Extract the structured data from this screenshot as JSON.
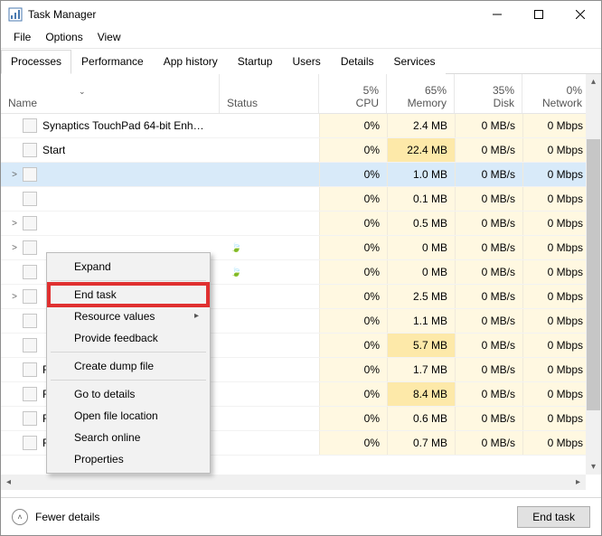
{
  "window": {
    "title": "Task Manager"
  },
  "menus": {
    "file": "File",
    "options": "Options",
    "view": "View"
  },
  "tabs": [
    "Processes",
    "Performance",
    "App history",
    "Startup",
    "Users",
    "Details",
    "Services"
  ],
  "headers": {
    "name": "Name",
    "status": "Status",
    "cpu": {
      "pct": "5%",
      "lbl": "CPU"
    },
    "mem": {
      "pct": "65%",
      "lbl": "Memory"
    },
    "disk": {
      "pct": "35%",
      "lbl": "Disk"
    },
    "net": {
      "pct": "0%",
      "lbl": "Network"
    }
  },
  "rows": [
    {
      "exp": "",
      "name": "Synaptics TouchPad 64-bit Enha...",
      "cpu": "0%",
      "mem": "2.4 MB",
      "disk": "0 MB/s",
      "net": "0 Mbps"
    },
    {
      "exp": "",
      "name": "Start",
      "cpu": "0%",
      "mem": "22.4 MB",
      "disk": "0 MB/s",
      "net": "0 Mbps"
    },
    {
      "exp": ">",
      "name": "",
      "cpu": "0%",
      "mem": "1.0 MB",
      "disk": "0 MB/s",
      "net": "0 Mbps",
      "sel": true
    },
    {
      "exp": "",
      "name": "",
      "cpu": "0%",
      "mem": "0.1 MB",
      "disk": "0 MB/s",
      "net": "0 Mbps"
    },
    {
      "exp": ">",
      "name": "",
      "cpu": "0%",
      "mem": "0.5 MB",
      "disk": "0 MB/s",
      "net": "0 Mbps"
    },
    {
      "exp": ">",
      "name": "",
      "cpu": "0%",
      "mem": "0 MB",
      "disk": "0 MB/s",
      "net": "0 Mbps",
      "leaf": true
    },
    {
      "exp": "",
      "name": "",
      "cpu": "0%",
      "mem": "0 MB",
      "disk": "0 MB/s",
      "net": "0 Mbps",
      "leaf": true
    },
    {
      "exp": ">",
      "name": "",
      "cpu": "0%",
      "mem": "2.5 MB",
      "disk": "0 MB/s",
      "net": "0 Mbps"
    },
    {
      "exp": "",
      "name": "",
      "cpu": "0%",
      "mem": "1.1 MB",
      "disk": "0 MB/s",
      "net": "0 Mbps"
    },
    {
      "exp": "",
      "name": "",
      "cpu": "0%",
      "mem": "5.7 MB",
      "disk": "0 MB/s",
      "net": "0 Mbps"
    },
    {
      "exp": "",
      "name": "Runtime Broker",
      "cpu": "0%",
      "mem": "1.7 MB",
      "disk": "0 MB/s",
      "net": "0 Mbps"
    },
    {
      "exp": "",
      "name": "Runtime Broker",
      "cpu": "0%",
      "mem": "8.4 MB",
      "disk": "0 MB/s",
      "net": "0 Mbps"
    },
    {
      "exp": "",
      "name": "Realtek HD Audio Universal Serv...",
      "cpu": "0%",
      "mem": "0.6 MB",
      "disk": "0 MB/s",
      "net": "0 Mbps"
    },
    {
      "exp": "",
      "name": "Realtek HD Audio Universal Serv...",
      "cpu": "0%",
      "mem": "0.7 MB",
      "disk": "0 MB/s",
      "net": "0 Mbps"
    }
  ],
  "context": {
    "expand": "Expand",
    "endtask": "End task",
    "resources": "Resource values",
    "feedback": "Provide feedback",
    "dump": "Create dump file",
    "details": "Go to details",
    "openloc": "Open file location",
    "search": "Search online",
    "props": "Properties"
  },
  "footer": {
    "fewer": "Fewer details",
    "endtask": "End task"
  }
}
